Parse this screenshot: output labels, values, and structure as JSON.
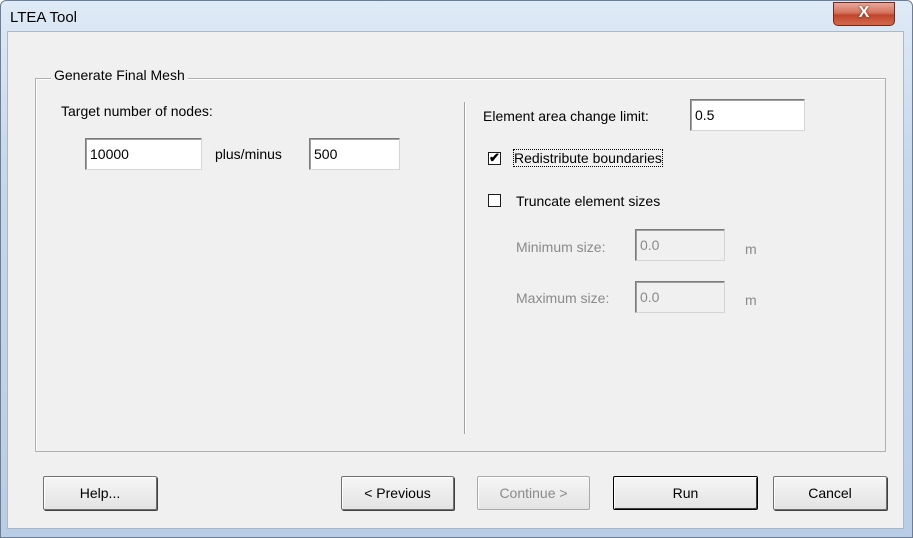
{
  "window": {
    "title": "LTEA Tool",
    "close_label": "X"
  },
  "group": {
    "title": "Generate Final Mesh"
  },
  "left": {
    "target_label": "Target number of nodes:",
    "target_value": "10000",
    "plusminus_label": "plus/minus",
    "plusminus_value": "500"
  },
  "right": {
    "area_label": "Element area change limit:",
    "area_value": "0.5",
    "redistribute_label": "Redistribute boundaries",
    "redistribute_checked": true,
    "truncate_label": "Truncate element sizes",
    "truncate_checked": false,
    "min_label": "Minimum size:",
    "min_value": "0.0",
    "min_unit": "m",
    "max_label": "Maximum size:",
    "max_value": "0.0",
    "max_unit": "m"
  },
  "buttons": {
    "help": "Help...",
    "previous": "< Previous",
    "continue": "Continue >",
    "run": "Run",
    "cancel": "Cancel"
  },
  "colors": {
    "dialog_bg": "#f0f0f0",
    "close_button": "#c7503a",
    "disabled_text": "#8a8a8a"
  }
}
